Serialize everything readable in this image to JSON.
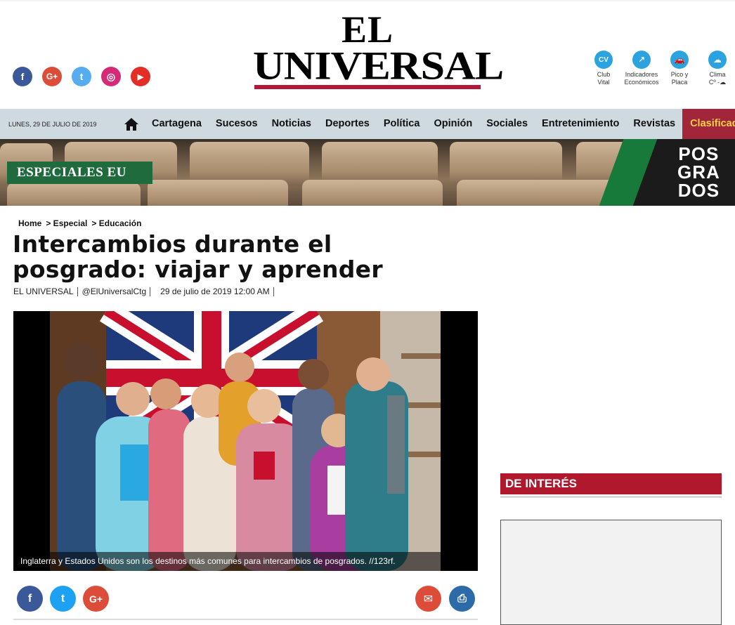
{
  "header": {
    "logo_line1": "EL",
    "logo_line2": "UNIVERSAL",
    "social": [
      {
        "name": "facebook",
        "glyph": "f",
        "color": "#3b5998"
      },
      {
        "name": "google-plus",
        "glyph": "G+",
        "color": "#dd4b39"
      },
      {
        "name": "twitter",
        "glyph": "t",
        "color": "#55acee"
      },
      {
        "name": "instagram",
        "glyph": "◎",
        "color": "#d62976"
      },
      {
        "name": "youtube",
        "glyph": "▶",
        "color": "#e52d27"
      }
    ],
    "quick_links": [
      {
        "icon": "CV",
        "label1": "Club",
        "label2": "Vital"
      },
      {
        "icon": "↗",
        "label1": "Indicadores",
        "label2": "Económicos"
      },
      {
        "icon": "🚗",
        "label1": "Pico y",
        "label2": "Placa"
      },
      {
        "icon": "☁",
        "label1": "Clima",
        "label2": "Cº -☁"
      }
    ]
  },
  "nav": {
    "date": "LUNES, 29 DE JULIO DE 2019",
    "items": [
      "Cartagena",
      "Sucesos",
      "Noticias",
      "Deportes",
      "Política",
      "Opinión",
      "Sociales",
      "Entretenimiento",
      "Revistas"
    ],
    "classified": "Clasificados"
  },
  "banner": {
    "section": "ESPECIALES EU",
    "posgrados_lines": [
      "POS",
      "GRA",
      "DOS"
    ]
  },
  "article": {
    "breadcrumb": [
      "Home",
      "> Especial",
      "> Educación"
    ],
    "title": "Intercambios durante el posgrado: viajar y aprender",
    "author": "EL UNIVERSAL",
    "handle": "@ElUniversalCtg",
    "date": "29 de julio de 2019 12:00 AM",
    "caption": "Inglaterra y Estados Unidos son los destinos más comunes para intercambios de posgrados. //123rf."
  },
  "share": {
    "left": [
      {
        "name": "facebook",
        "glyph": "f",
        "color": "#3b5998"
      },
      {
        "name": "twitter",
        "glyph": "t",
        "color": "#1da1f2"
      },
      {
        "name": "google-plus",
        "glyph": "G+",
        "color": "#dd4b39"
      }
    ],
    "right": [
      {
        "name": "email",
        "glyph": "✉",
        "color": "#dd4b39"
      },
      {
        "name": "print",
        "glyph": "⎙",
        "color": "#2c6aa8"
      }
    ]
  },
  "sidebar": {
    "interest_title": "DE INTERÉS"
  }
}
